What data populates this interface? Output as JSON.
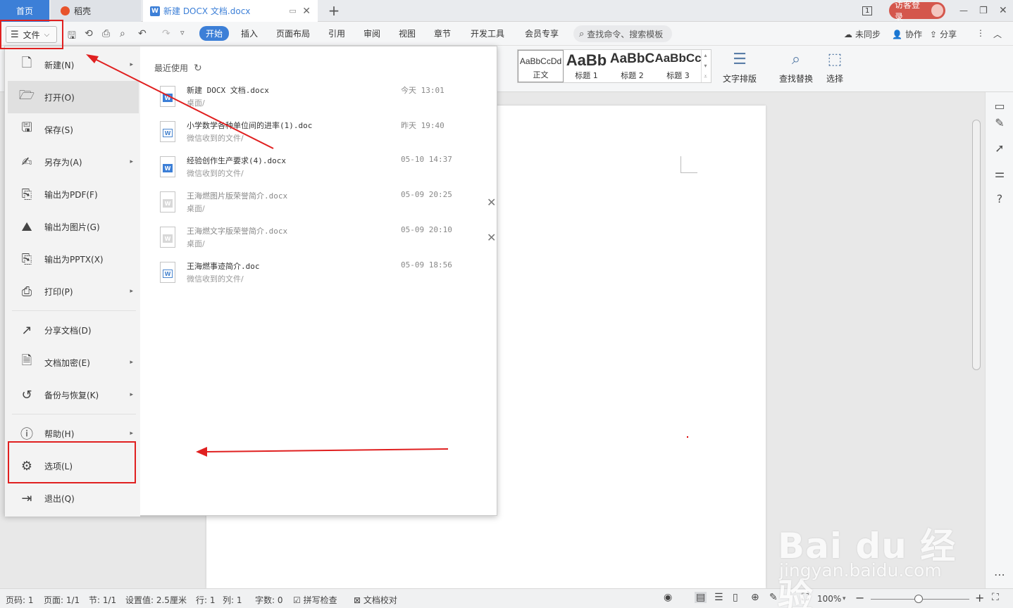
{
  "titlebar": {
    "home_tab": "首页",
    "daoke_tab": "稻壳",
    "doc_tab": "新建 DOCX 文档.docx",
    "doc_tab_close": "✕",
    "new_tab": "+",
    "page_indicator": "1",
    "guest_login": "访客登录",
    "minimize": "—",
    "restore": "❐",
    "close": "✕"
  },
  "toolbar": {
    "file_label": "文件",
    "tabs": [
      "开始",
      "插入",
      "页面布局",
      "引用",
      "审阅",
      "视图",
      "章节",
      "开发工具",
      "会员专享"
    ],
    "search_placeholder": "查找命令、搜索模板",
    "unsynced": "未同步",
    "collaborate": "协作",
    "share": "分享"
  },
  "ribbon": {
    "styles": [
      {
        "sample": "AaBbCcDd",
        "name": "正文"
      },
      {
        "sample": "AaBb",
        "name": "标题 1"
      },
      {
        "sample": "AaBbC",
        "name": "标题 2"
      },
      {
        "sample": "AaBbCc",
        "name": "标题 3"
      }
    ],
    "text_layout": "文字排版",
    "find_replace": "查找替换",
    "select": "选择"
  },
  "file_menu": {
    "items": [
      {
        "label": "新建(N)",
        "icon": "new-doc-icon",
        "submenu": true
      },
      {
        "label": "打开(O)",
        "icon": "open-folder-icon",
        "submenu": false
      },
      {
        "label": "保存(S)",
        "icon": "save-icon",
        "submenu": false
      },
      {
        "label": "另存为(A)",
        "icon": "save-as-icon",
        "submenu": true
      },
      {
        "label": "输出为PDF(F)",
        "icon": "export-pdf-icon",
        "submenu": false
      },
      {
        "label": "输出为图片(G)",
        "icon": "export-image-icon",
        "submenu": false
      },
      {
        "label": "输出为PPTX(X)",
        "icon": "export-pptx-icon",
        "submenu": false
      },
      {
        "label": "打印(P)",
        "icon": "print-icon",
        "submenu": true
      },
      {
        "label": "分享文档(D)",
        "icon": "share-doc-icon",
        "submenu": false
      },
      {
        "label": "文档加密(E)",
        "icon": "encrypt-icon",
        "submenu": true
      },
      {
        "label": "备份与恢复(K)",
        "icon": "backup-icon",
        "submenu": true
      },
      {
        "label": "帮助(H)",
        "icon": "help-icon",
        "submenu": true
      },
      {
        "label": "选项(L)",
        "icon": "gear-icon",
        "submenu": false
      },
      {
        "label": "退出(Q)",
        "icon": "exit-icon",
        "submenu": false
      }
    ],
    "recent_title": "最近使用",
    "recent": [
      {
        "name": "新建 DOCX 文档.docx",
        "path": "桌面/",
        "time": "今天 13:01"
      },
      {
        "name": "小学数学各种单位间的进率(1).doc",
        "path": "微信收到的文件/",
        "time": "昨天 19:40"
      },
      {
        "name": "经验创作生产要求(4).docx",
        "path": "微信收到的文件/",
        "time": "05-10 14:37"
      },
      {
        "name": "王海燃图片版荣誉简介.docx",
        "path": "桌面/",
        "time": "05-09 20:25"
      },
      {
        "name": "王海燃文字版荣誉简介.docx",
        "path": "桌面/",
        "time": "05-09 20:10"
      },
      {
        "name": "王海燃事迹简介.doc",
        "path": "微信收到的文件/",
        "time": "05-09 18:56"
      }
    ]
  },
  "statusbar": {
    "page_no": "页码: 1",
    "pages": "页面: 1/1",
    "section": "节: 1/1",
    "setting": "设置值: 2.5厘米",
    "row": "行: 1",
    "col": "列: 1",
    "words": "字数: 0",
    "spell_check": "拼写检查",
    "doc_proof": "文档校对",
    "zoom": "100%"
  },
  "watermark": {
    "line1": "Bai du 经验",
    "line2": "jingyan.baidu.com"
  },
  "colors": {
    "accent": "#3c7fd7",
    "annotation": "#e02020",
    "guest": "#d4564c"
  }
}
